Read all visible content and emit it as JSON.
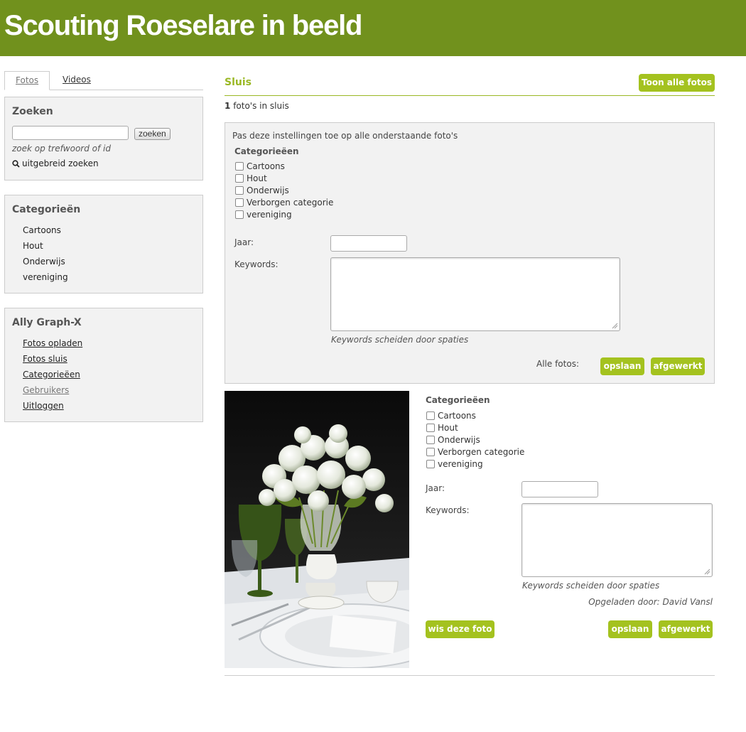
{
  "header": {
    "title": "Scouting Roeselare in beeld"
  },
  "sidebar": {
    "tabs": [
      {
        "label": "Fotos"
      },
      {
        "label": "Videos"
      }
    ],
    "search": {
      "title": "Zoeken",
      "button": "zoeken",
      "hint": "zoek op trefwoord of id",
      "advanced": "uitgebreid zoeken",
      "icon": "search-icon"
    },
    "categories": {
      "title": "Categorieën",
      "items": [
        "Cartoons",
        "Hout",
        "Onderwijs",
        "vereniging"
      ]
    },
    "admin": {
      "title": "Ally Graph-X",
      "links": [
        "Fotos opladen",
        "Fotos sluis",
        "Categorieëen",
        "Gebruikers",
        "Uitloggen"
      ]
    }
  },
  "main": {
    "title": "Sluis",
    "show_all_button": "Toon alle fotos",
    "count_number": "1",
    "count_text": "foto's in sluis",
    "bulk": {
      "intro": "Pas deze instellingen toe op alle onderstaande foto's",
      "categories_label": "Categorieëen",
      "categories": [
        "Cartoons",
        "Hout",
        "Onderwijs",
        "Verborgen categorie",
        "vereniging"
      ],
      "year_label": "Jaar:",
      "year_value": "",
      "keywords_label": "Keywords:",
      "keywords_value": "",
      "keywords_hint": "Keywords scheiden door spaties",
      "all_photos_label": "Alle fotos:",
      "save_button": "opslaan",
      "done_button": "afgewerkt"
    },
    "photo": {
      "categories_label": "Categorieëen",
      "categories": [
        "Cartoons",
        "Hout",
        "Onderwijs",
        "Verborgen categorie",
        "vereniging"
      ],
      "year_label": "Jaar:",
      "year_value": "",
      "keywords_label": "Keywords:",
      "keywords_value": "",
      "keywords_hint": "Keywords scheiden door spaties",
      "uploaded_by": "Opgeladen door: David Vansl",
      "delete_button": "wis deze foto",
      "save_button": "opslaan",
      "done_button": "afgewerkt"
    }
  },
  "colors": {
    "header": "#71911d",
    "accent": "#a4c21f",
    "title": "#9ab824"
  }
}
